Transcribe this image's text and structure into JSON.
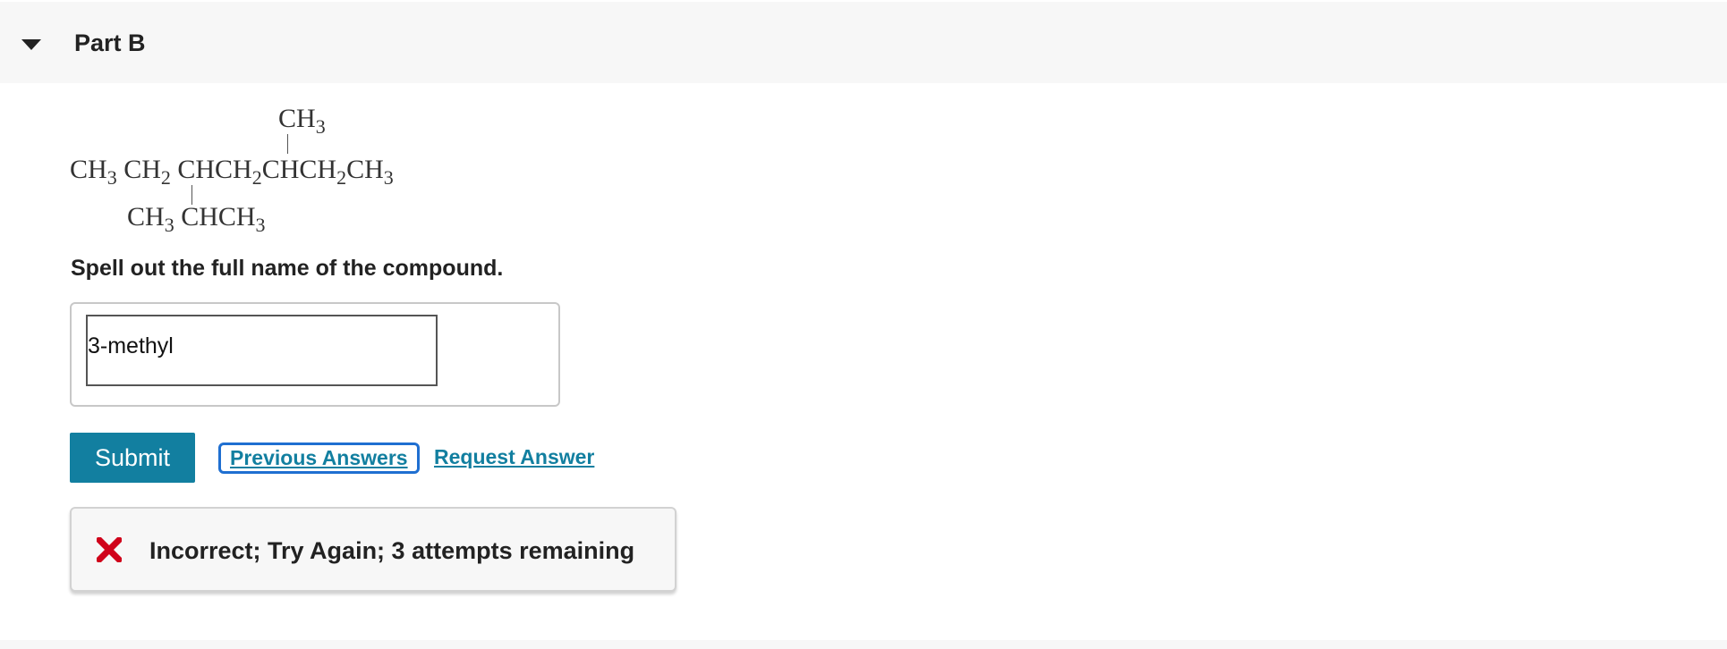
{
  "part": {
    "title": "Part B",
    "toggle_icon": "caret-down-icon"
  },
  "structure": {
    "top_substituent": [
      "CH",
      "3"
    ],
    "main_chain": [
      [
        "CH",
        "3"
      ],
      [
        "CH",
        "2"
      ],
      [
        "CHCH",
        "2"
      ],
      [
        "CHCH",
        "2"
      ],
      [
        "CH",
        "3"
      ]
    ],
    "bottom_substituent": [
      [
        "CH",
        "3"
      ],
      [
        "CHCH",
        "3"
      ]
    ]
  },
  "question": {
    "instruction": "Spell out the full name of the compound."
  },
  "answer": {
    "value": "3-methyl"
  },
  "actions": {
    "submit_label": "Submit",
    "previous_answers_label": "Previous Answers",
    "request_answer_label": "Request Answer"
  },
  "feedback": {
    "icon": "x-icon",
    "icon_color": "#d0021b",
    "message": "Incorrect; Try Again; 3 attempts remaining"
  },
  "colors": {
    "accent": "#127fa0",
    "focus": "#1f6fd1",
    "error": "#d0021b"
  }
}
